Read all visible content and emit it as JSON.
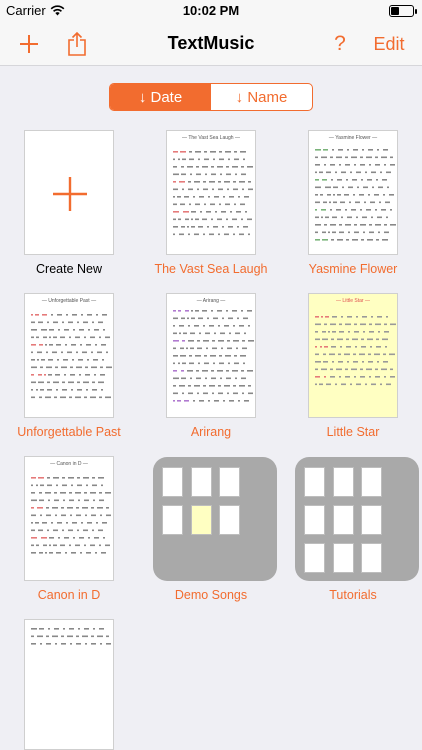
{
  "status": {
    "carrier": "Carrier",
    "time": "10:02 PM"
  },
  "nav": {
    "title": "TextMusic",
    "help_label": "?",
    "edit_label": "Edit"
  },
  "sort": {
    "date_label": "↓ Date",
    "name_label": "↓ Name",
    "selected": "date"
  },
  "colors": {
    "accent": "#f26c2f",
    "folder": "#a9a9a9",
    "note_yellow": "#ffffc2"
  },
  "items": [
    {
      "label": "Create New",
      "kind": "new"
    },
    {
      "label": "The Vast Sea Laugh",
      "kind": "document",
      "page_title": "— The Vast Sea Laugh —"
    },
    {
      "label": "Yasmine Flower",
      "kind": "document",
      "page_title": "— Yasmine Flower —"
    },
    {
      "label": "Unforgettable Past",
      "kind": "document",
      "page_title": "— Unforgettable Past —"
    },
    {
      "label": "Arirang",
      "kind": "document",
      "page_title": "— Arirang —"
    },
    {
      "label": "Little Star",
      "kind": "document",
      "page_title": "— Little Star —"
    },
    {
      "label": "Canon in D",
      "kind": "document",
      "page_title": "— Canon in D —"
    },
    {
      "label": "Demo Songs",
      "kind": "folder"
    },
    {
      "label": "Tutorials",
      "kind": "folder"
    },
    {
      "label": "",
      "kind": "document",
      "page_title": ""
    }
  ]
}
